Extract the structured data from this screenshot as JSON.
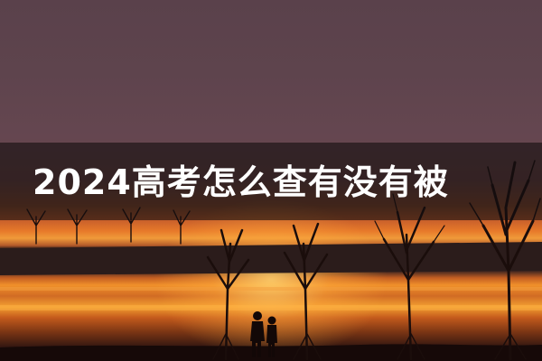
{
  "headline": {
    "text": "2024高考怎么查有没有被"
  },
  "colors": {
    "sky": "#5e444d",
    "sunset": "#f09a3a",
    "band": "#140e10",
    "text": "#ffffff"
  }
}
